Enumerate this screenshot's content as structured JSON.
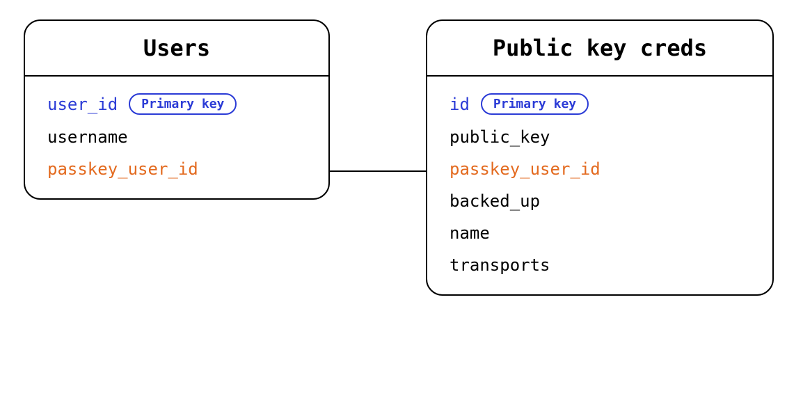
{
  "entities": {
    "users": {
      "title": "Users",
      "fields": [
        {
          "name": "user_id",
          "type": "pk",
          "badge": "Primary key"
        },
        {
          "name": "username",
          "type": "normal"
        },
        {
          "name": "passkey_user_id",
          "type": "fk"
        }
      ]
    },
    "creds": {
      "title": "Public key creds",
      "fields": [
        {
          "name": "id",
          "type": "pk",
          "badge": "Primary key"
        },
        {
          "name": "public_key",
          "type": "normal"
        },
        {
          "name": "passkey_user_id",
          "type": "fk"
        },
        {
          "name": "backed_up",
          "type": "normal"
        },
        {
          "name": "name",
          "type": "normal"
        },
        {
          "name": "transports",
          "type": "normal"
        }
      ]
    }
  },
  "relationship": {
    "from": "users.passkey_user_id",
    "to": "creds.passkey_user_id"
  }
}
